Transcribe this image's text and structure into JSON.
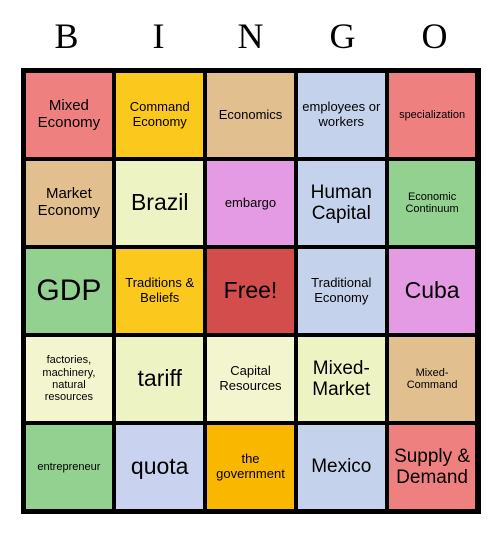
{
  "card": {
    "title_letters": [
      "B",
      "I",
      "N",
      "G",
      "O"
    ],
    "free_space_label": "Free!",
    "colors": {
      "salmon": "#ef8080",
      "gold": "#fbc81e",
      "tan": "#e2bf8f",
      "light_blue": "#c5d2ec",
      "pale_yellow_green": "#eef3c4",
      "orchid": "#e49be4",
      "green": "#92d18f",
      "light_green": "#92d18f",
      "crimson": "#d34d4d",
      "pale_yellow": "#f3f5cf",
      "lavender": "#c9d2ee",
      "orange_gold": "#f9b700",
      "border": "#000000",
      "text": "#000000"
    },
    "rows": [
      [
        {
          "text": "Mixed Economy",
          "bg": "#ef8080",
          "size": "fs-md"
        },
        {
          "text": "Command Economy",
          "bg": "#fbc81e",
          "size": "fs-sm"
        },
        {
          "text": "Economics",
          "bg": "#e2bf8f",
          "size": "fs-sm"
        },
        {
          "text": "employees or workers",
          "bg": "#c5d2ec",
          "size": "fs-sm"
        },
        {
          "text": "specialization",
          "bg": "#ef8080",
          "size": "fs-xs"
        }
      ],
      [
        {
          "text": "Market Economy",
          "bg": "#e2bf8f",
          "size": "fs-md"
        },
        {
          "text": "Brazil",
          "bg": "#eef3c4",
          "size": "fs-xl"
        },
        {
          "text": "embargo",
          "bg": "#e49be4",
          "size": "fs-sm"
        },
        {
          "text": "Human Capital",
          "bg": "#c5d2ec",
          "size": "fs-lg"
        },
        {
          "text": "Economic Continuum",
          "bg": "#92d18f",
          "size": "fs-xs"
        }
      ],
      [
        {
          "text": "GDP",
          "bg": "#92d18f",
          "size": "fs-xxl"
        },
        {
          "text": "Traditions & Beliefs",
          "bg": "#fbc81e",
          "size": "fs-sm"
        },
        {
          "text": "Free!",
          "bg": "#d34d4d",
          "size": "fs-xl"
        },
        {
          "text": "Traditional Economy",
          "bg": "#c5d2ec",
          "size": "fs-sm"
        },
        {
          "text": "Cuba",
          "bg": "#e49be4",
          "size": "fs-xl"
        }
      ],
      [
        {
          "text": "factories, machinery, natural resources",
          "bg": "#f3f5cf",
          "size": "fs-xs"
        },
        {
          "text": "tariff",
          "bg": "#eef3c4",
          "size": "fs-xl"
        },
        {
          "text": "Capital Resources",
          "bg": "#f3f5cf",
          "size": "fs-sm"
        },
        {
          "text": "Mixed-Market",
          "bg": "#eef3c4",
          "size": "fs-lg"
        },
        {
          "text": "Mixed-Command",
          "bg": "#e2bf8f",
          "size": "fs-xs"
        }
      ],
      [
        {
          "text": "entrepreneur",
          "bg": "#92d18f",
          "size": "fs-xs"
        },
        {
          "text": "quota",
          "bg": "#c9d2ee",
          "size": "fs-xl"
        },
        {
          "text": "the government",
          "bg": "#f9b700",
          "size": "fs-sm"
        },
        {
          "text": "Mexico",
          "bg": "#c5d2ec",
          "size": "fs-lg"
        },
        {
          "text": "Supply & Demand",
          "bg": "#ef8080",
          "size": "fs-lg"
        }
      ]
    ]
  }
}
